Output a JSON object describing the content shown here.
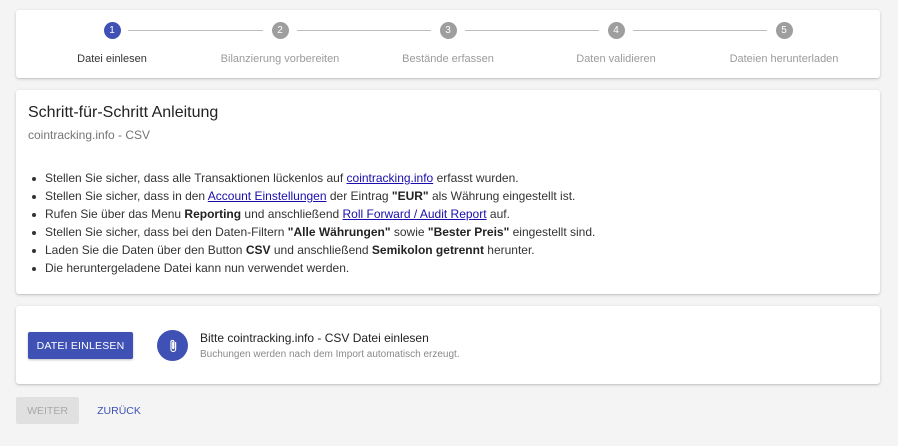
{
  "stepper": {
    "steps": [
      {
        "number": "1",
        "label": "Datei einlesen"
      },
      {
        "number": "2",
        "label": "Bilanzierung vorbereiten"
      },
      {
        "number": "3",
        "label": "Bestände erfassen"
      },
      {
        "number": "4",
        "label": "Daten validieren"
      },
      {
        "number": "5",
        "label": "Dateien herunterladen"
      }
    ],
    "active_color": "#3f51b5",
    "inactive_color": "#9e9e9e"
  },
  "guide": {
    "title": "Schritt-für-Schritt Anleitung",
    "subtitle": "cointracking.info - CSV",
    "items": [
      {
        "t1": "Stellen Sie sicher, dass alle Transaktionen lückenlos auf ",
        "link": "cointracking.info",
        "t2": " erfasst wurden."
      },
      {
        "t1": "Stellen Sie sicher, dass in den ",
        "link": "Account Einstellungen",
        "t2": " der Eintrag ",
        "b1": "\"EUR\"",
        "t3": " als Währung eingestellt ist."
      },
      {
        "t1": "Rufen Sie über das Menu ",
        "b1": "Reporting",
        "t2": " und anschließend ",
        "link": "Roll Forward / Audit Report",
        "t3": " auf."
      },
      {
        "t1": "Stellen Sie sicher, dass bei den Daten-Filtern ",
        "b1": "\"Alle Währungen\"",
        "t2": " sowie ",
        "b2": "\"Bester Preis\"",
        "t3": " eingestellt sind."
      },
      {
        "t1": "Laden Sie die Daten über den Button ",
        "b1": "CSV",
        "t2": " und anschließend ",
        "b2": "Semikolon getrennt",
        "t3": " herunter."
      },
      {
        "t1": "Die heruntergeladene Datei kann nun verwendet werden."
      }
    ]
  },
  "upload": {
    "button_label": "DATEI EINLESEN",
    "icon": "paperclip-icon",
    "main_text": "Bitte cointracking.info - CSV Datei einlesen",
    "sub_text": "Buchungen werden nach dem Import automatisch erzeugt."
  },
  "footer": {
    "next_label": "WEITER",
    "back_label": "ZURÜCK"
  },
  "colors": {
    "primary": "#3f51b5",
    "link": "#1a0dab",
    "background": "#f4f4f4"
  }
}
